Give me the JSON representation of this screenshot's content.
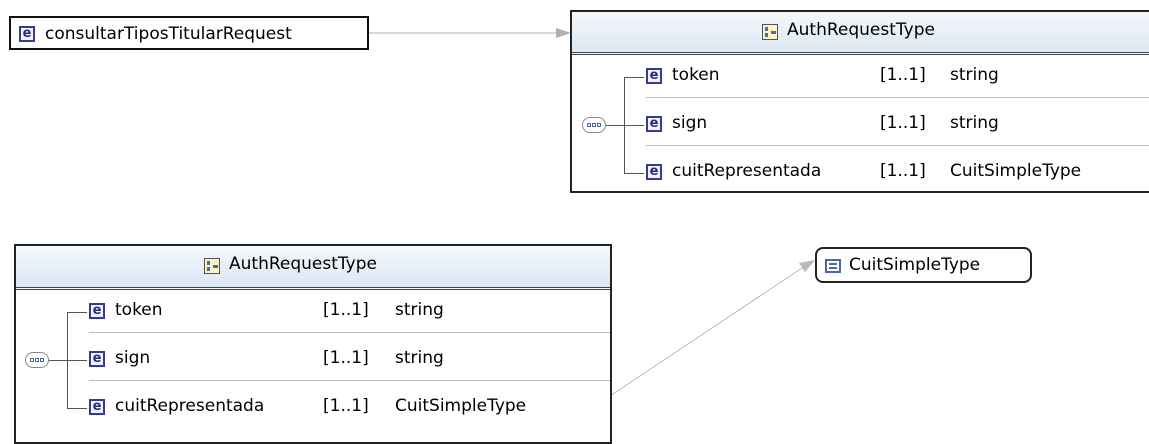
{
  "root_element": {
    "name": "consultarTiposTitularRequest",
    "icon": "e"
  },
  "types": [
    {
      "title": "AuthRequestType",
      "rows": [
        {
          "icon": "e",
          "name": "token",
          "cardinality": "[1..1]",
          "type": "string"
        },
        {
          "icon": "e",
          "name": "sign",
          "cardinality": "[1..1]",
          "type": "string"
        },
        {
          "icon": "e",
          "name": "cuitRepresentada",
          "cardinality": "[1..1]",
          "type": "CuitSimpleType"
        }
      ]
    },
    {
      "title": "AuthRequestType",
      "rows": [
        {
          "icon": "e",
          "name": "token",
          "cardinality": "[1..1]",
          "type": "string"
        },
        {
          "icon": "e",
          "name": "sign",
          "cardinality": "[1..1]",
          "type": "string"
        },
        {
          "icon": "e",
          "name": "cuitRepresentada",
          "cardinality": "[1..1]",
          "type": "CuitSimpleType"
        }
      ]
    }
  ],
  "simple_type": {
    "name": "CuitSimpleType"
  }
}
